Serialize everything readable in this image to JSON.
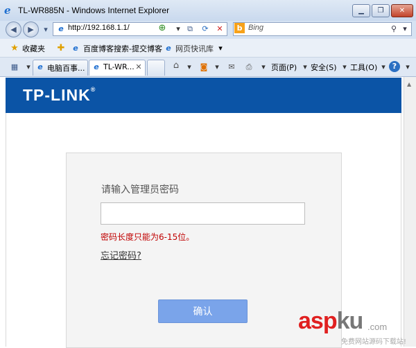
{
  "window": {
    "title": "TL-WR885N - Windows Internet Explorer",
    "minimize_icon": "▁",
    "maximize_icon": "❐",
    "close_icon": "✕"
  },
  "address_bar": {
    "url": "http://192.168.1.1/",
    "search_placeholder": "Bing"
  },
  "favorites_bar": {
    "favorites_label": "收藏夹",
    "items": [
      "百度博客搜索-提交博客",
      "网页快讯库"
    ]
  },
  "tabs": [
    "电脑百事...",
    "TL-WR..."
  ],
  "command_bar": {
    "page_label": "页面(P)",
    "safety_label": "安全(S)",
    "tools_label": "工具(O)"
  },
  "banner": {
    "logo_text": "TP-LINK",
    "logo_mark": "®",
    "color": "#0b54a6"
  },
  "login": {
    "prompt": "请输入管理员密码",
    "password_value": "",
    "error_message": "密码长度只能为6-15位。",
    "forgot_link": "忘记密码?",
    "confirm_button": "确认"
  },
  "watermark": {
    "asp": "asp",
    "ku": "ku",
    "com": ".com",
    "subtitle": "免费网站源码下载站!"
  }
}
